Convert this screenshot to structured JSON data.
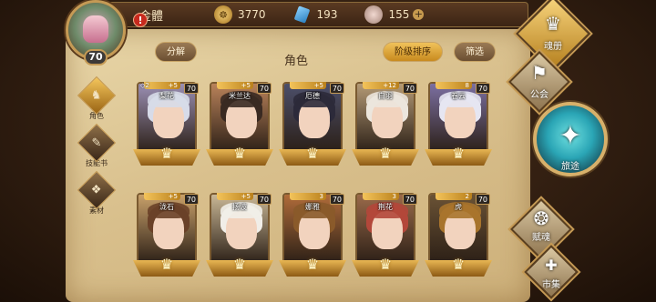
{
  "player": {
    "level": "70",
    "alert": "!"
  },
  "topbar": {
    "title": "金體",
    "gold": "3770",
    "gems": "193",
    "stones": "155",
    "add": "+"
  },
  "panel": {
    "title": "角色",
    "decompose_label": "分解",
    "sort_label": "阶级排序",
    "filter_label": "筛选"
  },
  "side_tabs": [
    {
      "label": "角色",
      "icon": "helmet-icon",
      "glyph": "♞"
    },
    {
      "label": "技能书",
      "icon": "book-icon",
      "glyph": "✎"
    },
    {
      "label": "素材",
      "icon": "material-icon",
      "glyph": "❖"
    }
  ],
  "cards": [
    {
      "name": "梨花",
      "sub": "◇2",
      "lvl": "70",
      "stars": "+5",
      "hair": "#d7dbe8",
      "bg": "#9a8fb3"
    },
    {
      "name": "米兰达",
      "sub": "",
      "lvl": "70",
      "stars": "+5",
      "hair": "#3a2a22",
      "bg": "#b9825a"
    },
    {
      "name": "厄德",
      "sub": "",
      "lvl": "70",
      "stars": "+5",
      "hair": "#2c2a3a",
      "bg": "#4c4f6a"
    },
    {
      "name": "白羽",
      "sub": "",
      "lvl": "70",
      "stars": "+12",
      "hair": "#ece6dd",
      "bg": "#b49a76"
    },
    {
      "name": "卷云",
      "sub": "",
      "lvl": "70",
      "stars": "8",
      "hair": "#e6e6f2",
      "bg": "#7b6fa1"
    },
    {
      "name": "泷石",
      "sub": "",
      "lvl": "70",
      "stars": "+5",
      "hair": "#6a4128",
      "bg": "#c8a06a"
    },
    {
      "name": "扬波",
      "sub": "",
      "lvl": "70",
      "stars": "+5",
      "hair": "#f1eee8",
      "bg": "#c9b796"
    },
    {
      "name": "娜雅",
      "sub": "",
      "lvl": "70",
      "stars": "3",
      "hair": "#8a5a2a",
      "bg": "#b06c3a"
    },
    {
      "name": "荆花",
      "sub": "",
      "lvl": "70",
      "stars": "3",
      "hair": "#b3473a",
      "bg": "#9a6a4a"
    },
    {
      "name": "虎",
      "sub": "",
      "lvl": "70",
      "stars": "2",
      "hair": "#a8742c",
      "bg": "#6a5235"
    }
  ],
  "right_menu": {
    "book": {
      "label": "魂册",
      "icon": "book-icon",
      "glyph": "♛"
    },
    "guild": {
      "label": "公会",
      "icon": "guild-icon",
      "glyph": "⚑"
    },
    "journey": {
      "label": "旅途",
      "icon": "journey-icon",
      "glyph": "✦"
    },
    "talent": {
      "label": "赋魂",
      "icon": "talent-icon",
      "glyph": "❂"
    },
    "market": {
      "label": "市集",
      "icon": "market-icon",
      "glyph": "✚"
    }
  }
}
